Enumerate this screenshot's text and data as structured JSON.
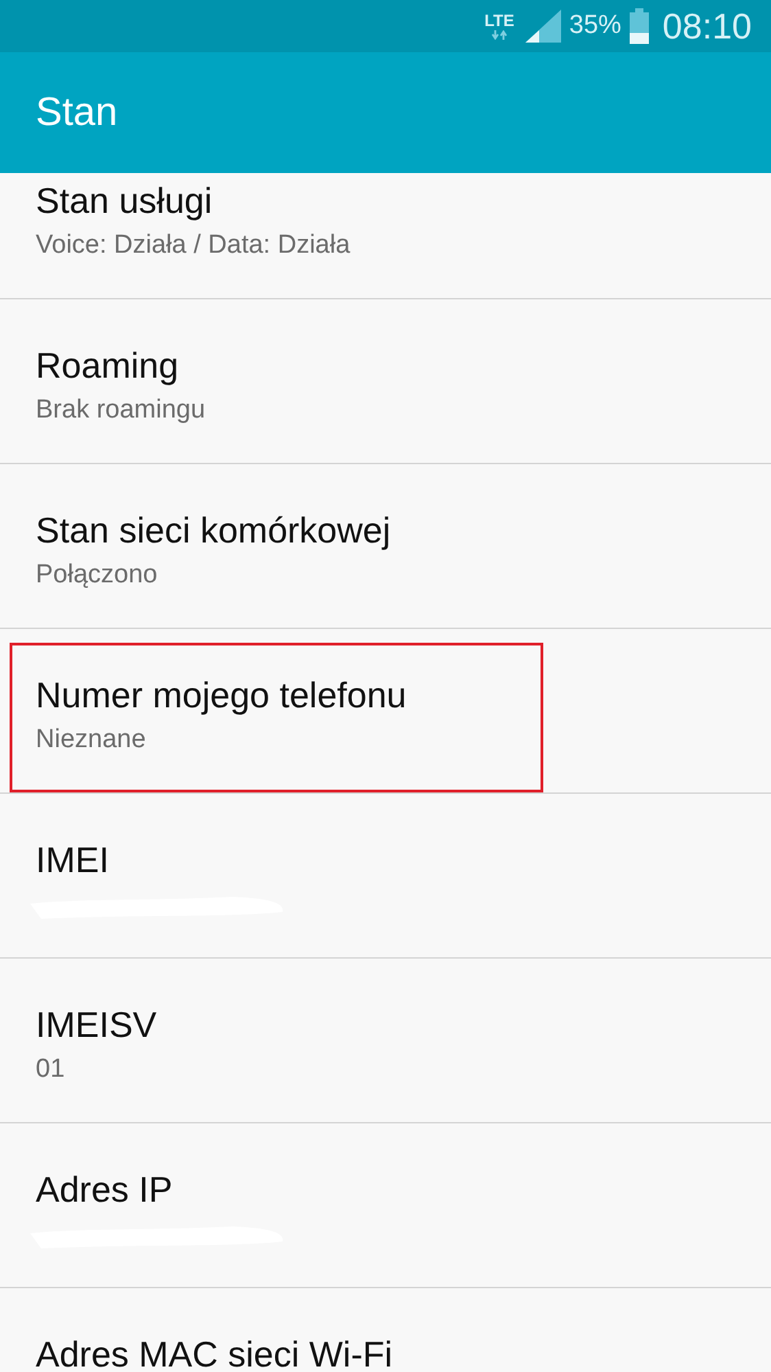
{
  "status_bar": {
    "network": "LTE",
    "battery": "35%",
    "time": "08:10"
  },
  "app_bar": {
    "title": "Stan"
  },
  "items": [
    {
      "kind": "text",
      "title": "Stan usługi",
      "value": "Voice: Działa / Data: Działa",
      "highlighted": false
    },
    {
      "kind": "text",
      "title": "Roaming",
      "value": "Brak roamingu",
      "highlighted": false
    },
    {
      "kind": "text",
      "title": "Stan sieci komórkowej",
      "value": "Połączono",
      "highlighted": false
    },
    {
      "kind": "text",
      "title": "Numer mojego telefonu",
      "value": "Nieznane",
      "highlighted": true
    },
    {
      "kind": "redacted",
      "title": "IMEI",
      "highlighted": false
    },
    {
      "kind": "text",
      "title": "IMEISV",
      "value": "01",
      "highlighted": false
    },
    {
      "kind": "redacted",
      "title": "Adres IP",
      "highlighted": false
    },
    {
      "kind": "text",
      "title": "Adres MAC sieci Wi-Fi",
      "highlighted": false
    }
  ]
}
